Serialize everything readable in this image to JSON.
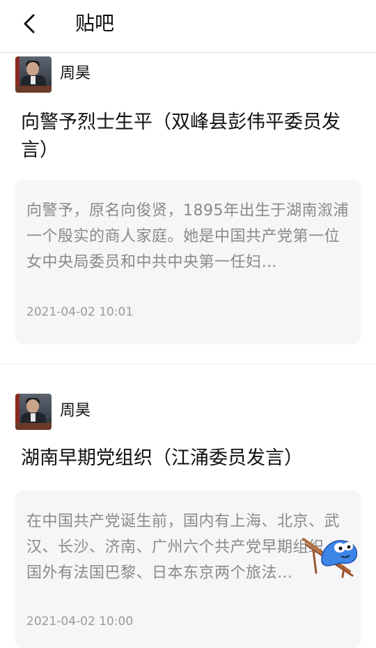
{
  "header": {
    "title": "贴吧"
  },
  "posts": [
    {
      "author": "周昊",
      "title": "向警予烈士生平（双峰县彭伟平委员发言）",
      "excerpt": "向警予，原名向俊贤，1895年出生于湖南溆浦一个殷实的商人家庭。她是中国共产党第一位女中央局委员和中共中央第一任妇…",
      "time": "2021-04-02 10:01"
    },
    {
      "author": "周昊",
      "title": "湖南早期党组织（江涌委员发言）",
      "excerpt": "在中国共产党诞生前，国内有上海、北京、武汉、长沙、济南、广州六个共产党早期组织。国外有法国巴黎、日本东京两个旅法…",
      "time": "2021-04-02 10:00"
    }
  ]
}
